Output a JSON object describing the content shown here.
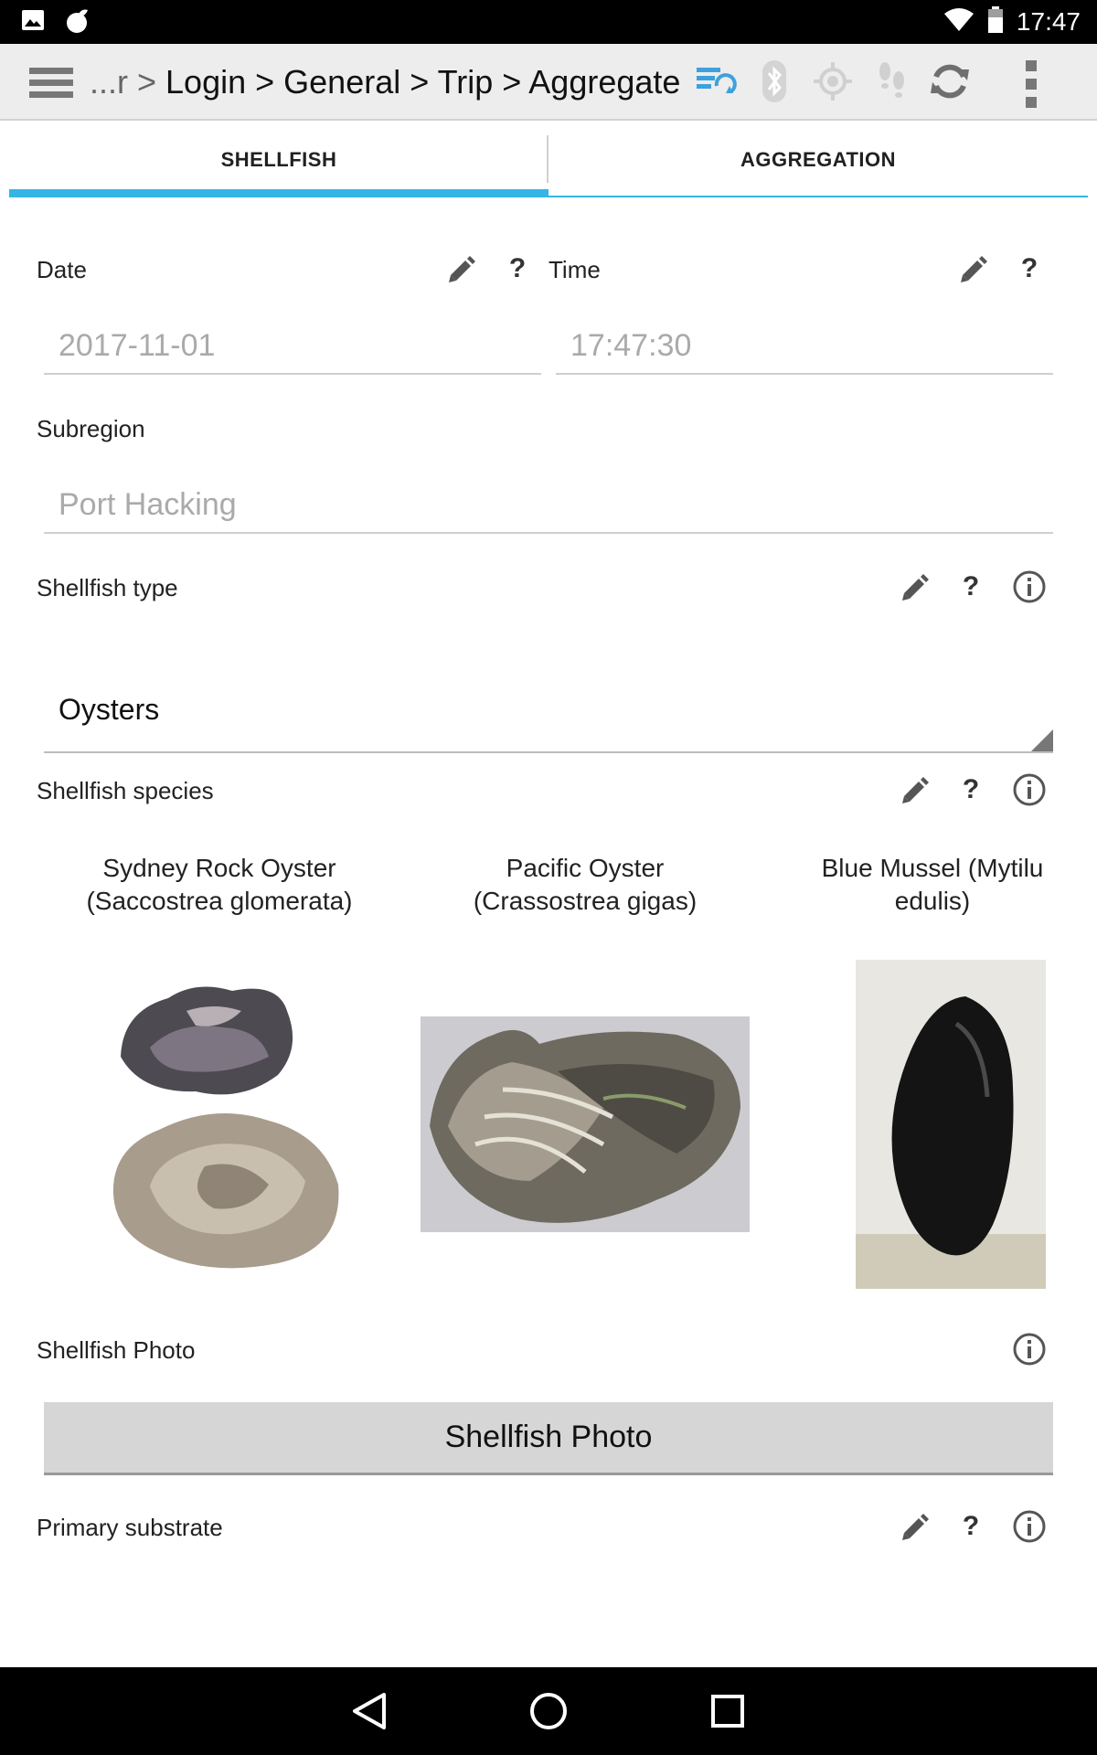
{
  "status_bar": {
    "time": "17:47"
  },
  "app_bar": {
    "breadcrumb_prefix": "...r > ",
    "breadcrumb": "Login > General > Trip > Aggregate"
  },
  "tabs": [
    {
      "label": "SHELLFISH",
      "active": true
    },
    {
      "label": "AGGREGATION",
      "active": false
    }
  ],
  "form": {
    "date": {
      "label": "Date",
      "value": "2017-11-01"
    },
    "time": {
      "label": "Time",
      "value": "17:47:30"
    },
    "subregion": {
      "label": "Subregion",
      "value": "Port Hacking"
    },
    "shellfish_type": {
      "label": "Shellfish type",
      "value": "Oysters"
    },
    "shellfish_species": {
      "label": "Shellfish species",
      "options": [
        {
          "line1": "Sydney Rock Oyster",
          "line2": "(Saccostrea glomerata)"
        },
        {
          "line1": "Pacific Oyster",
          "line2": "(Crassostrea gigas)"
        },
        {
          "line1": "Blue Mussel (Mytilu",
          "line2": "edulis)"
        }
      ]
    },
    "shellfish_photo": {
      "label": "Shellfish Photo",
      "button": "Shellfish Photo"
    },
    "primary_substrate": {
      "label": "Primary substrate"
    }
  },
  "help_glyph": "?",
  "colors": {
    "accent": "#33b5e5",
    "sync_icon": "#3da1dc"
  }
}
